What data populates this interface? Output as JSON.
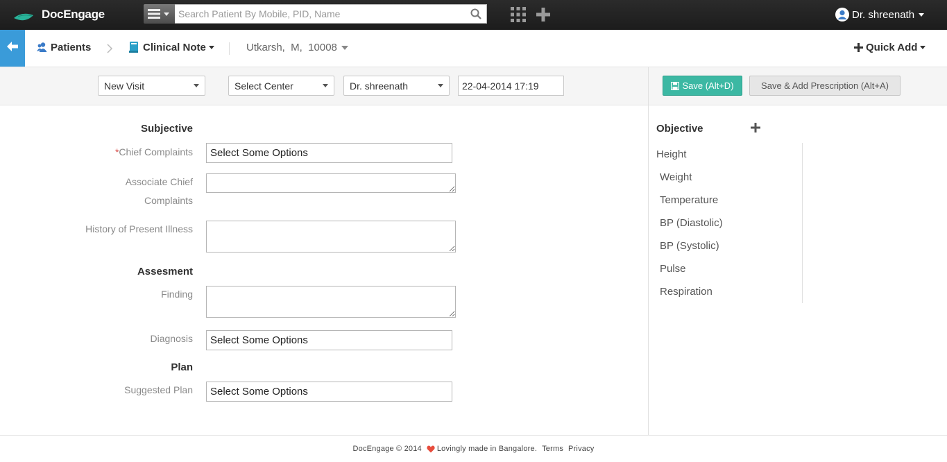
{
  "topbar": {
    "brand": "DocEngage",
    "search_placeholder": "Search Patient By Mobile, PID, Name",
    "user_name": "Dr. shreenath"
  },
  "breadcrumb": {
    "patients": "Patients",
    "clinical_note": "Clinical Note",
    "patient_info": "Utkarsh,  M,  10008",
    "quick_add": "Quick Add"
  },
  "toolbar": {
    "visit_type": "New Visit",
    "center": "Select Center",
    "doctor": "Dr. shreenath",
    "datetime": "22-04-2014 17:19",
    "save_label": "Save (Alt+D)",
    "save_rx_label": "Save & Add Prescription (Alt+A)"
  },
  "form": {
    "subjective_heading": "Subjective",
    "chief_complaints_label": "Chief Complaints",
    "chief_complaints_value": "Select Some Options",
    "associate_label_1": "Associate Chief",
    "associate_label_2": "Complaints",
    "history_label": "History of Present Illness",
    "assessment_heading": "Assesment",
    "finding_label": "Finding",
    "diagnosis_label": "Diagnosis",
    "diagnosis_value": "Select Some Options",
    "plan_heading": "Plan",
    "suggested_plan_label": "Suggested Plan",
    "suggested_plan_value": "Select Some Options"
  },
  "objective": {
    "title": "Objective",
    "items": [
      "Height",
      "Weight",
      "Temperature",
      "BP (Diastolic)",
      "BP (Systolic)",
      "Pulse",
      "Respiration"
    ]
  },
  "footer": {
    "copyright": "DocEngage © 2014",
    "tagline": "Lovingly made in Bangalore.",
    "terms": "Terms",
    "privacy": "Privacy"
  },
  "colors": {
    "accent_blue": "#3a9bd9",
    "save_green": "#3cb8a3",
    "brand_teal": "#2ab39a",
    "heart_red": "#e74c3c"
  }
}
